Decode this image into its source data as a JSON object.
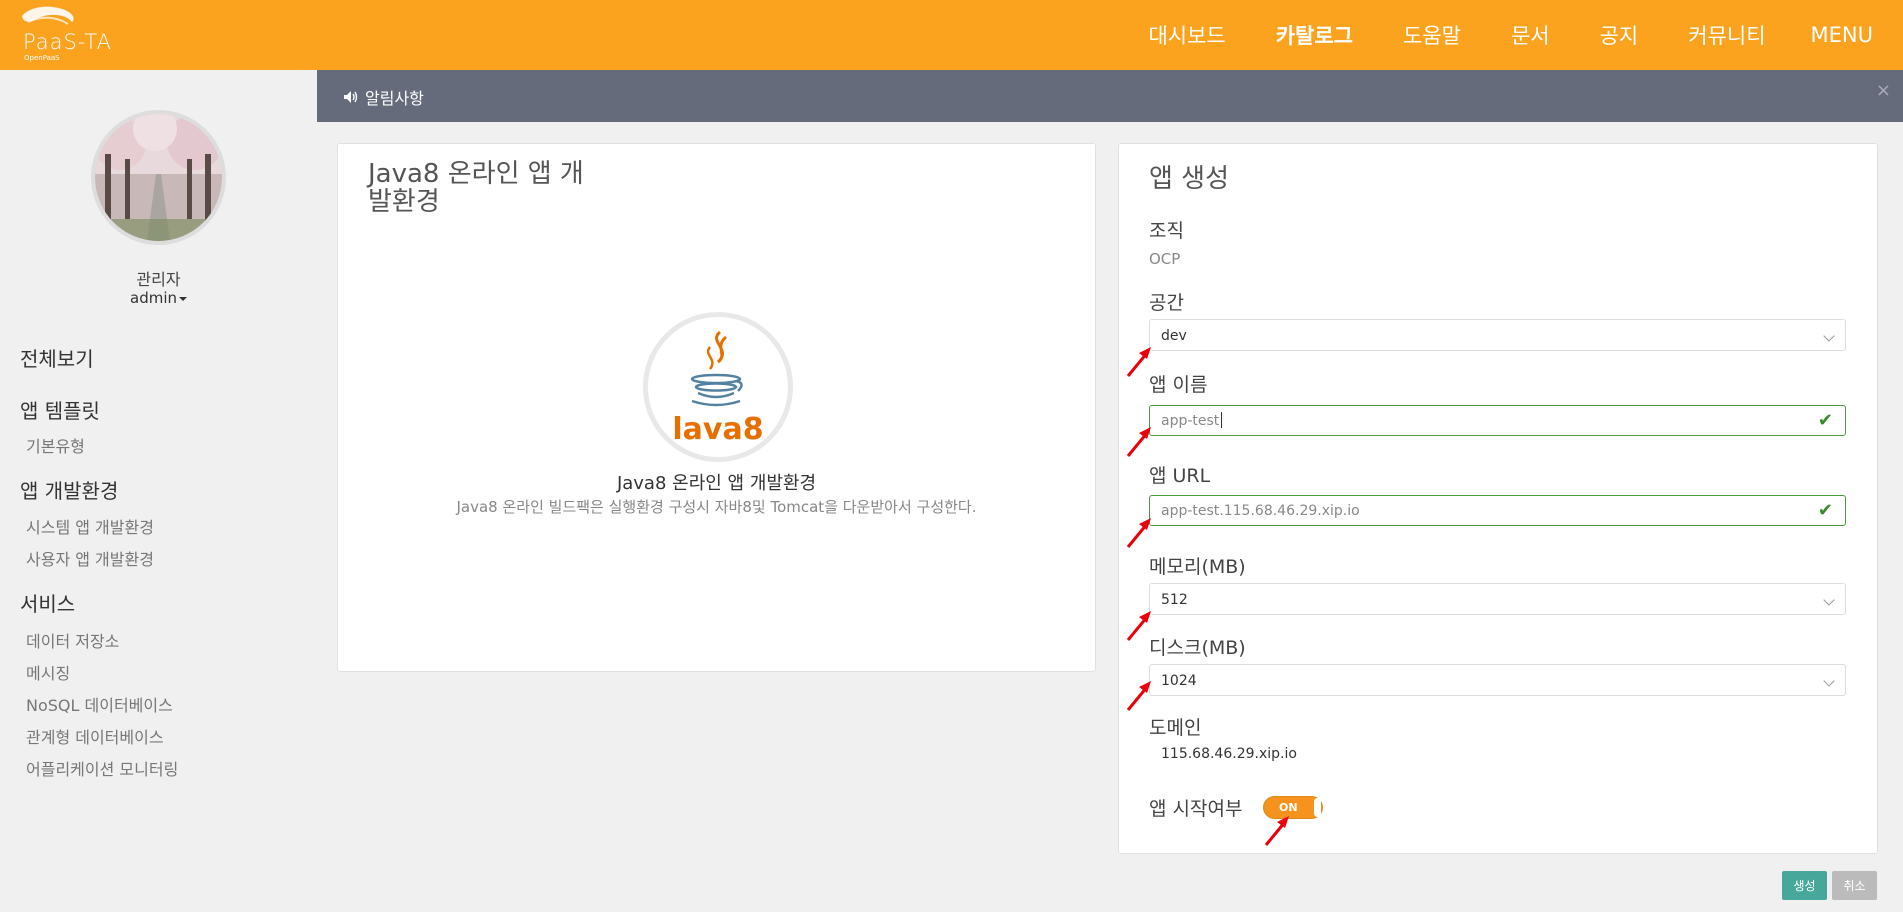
{
  "header": {
    "logo_text": "PaaS-TA",
    "logo_sub": "OpenPaaS",
    "nav": [
      "대시보드",
      "카탈로그",
      "도움말",
      "문서",
      "공지",
      "커뮤니티"
    ],
    "menu_label": "MENU",
    "active_nav": "카탈로그"
  },
  "sidebar": {
    "user_role": "관리자",
    "user_name": "admin",
    "sections": [
      {
        "title": "전체보기",
        "items": []
      },
      {
        "title": "앱 템플릿",
        "items": [
          "기본유형"
        ]
      },
      {
        "title": "앱 개발환경",
        "items": [
          "시스템 앱 개발환경",
          "사용자 앱 개발환경"
        ]
      },
      {
        "title": "서비스",
        "items": [
          "데이터 저장소",
          "메시징",
          "NoSQL 데이터베이스",
          "관계형 데이터베이스",
          "어플리케이션 모니터링"
        ]
      }
    ]
  },
  "notice": {
    "label": "알림사항",
    "close": "×"
  },
  "left_panel": {
    "title_line1": "Java8 온라인 앱 개",
    "title_line2": "발환경",
    "logo_text": "lava8",
    "caption": "Java8 온라인 앱 개발환경",
    "description": "Java8 온라인 빌드팩은 실행환경 구성시 자바8및 Tomcat을 다운받아서 구성한다."
  },
  "form": {
    "title": "앱 생성",
    "org_label": "조직",
    "org_value": "OCP",
    "space_label": "공간",
    "space_value": "dev",
    "app_name_label": "앱 이름",
    "app_name_value": "app-test",
    "app_url_label": "앱 URL",
    "app_url_value": "app-test.115.68.46.29.xip.io",
    "memory_label": "메모리(MB)",
    "memory_value": "512",
    "disk_label": "디스크(MB)",
    "disk_value": "1024",
    "domain_label": "도메인",
    "domain_value": "115.68.46.29.xip.io",
    "start_label": "앱 시작여부",
    "start_toggle": "ON"
  },
  "buttons": {
    "create": "생성",
    "cancel": "취소"
  },
  "colors": {
    "brand": "#fba31f",
    "notice_bg": "#656b7b",
    "valid": "#4a9a3c",
    "create_btn": "#46a79a",
    "arrow": "#e8000b"
  }
}
